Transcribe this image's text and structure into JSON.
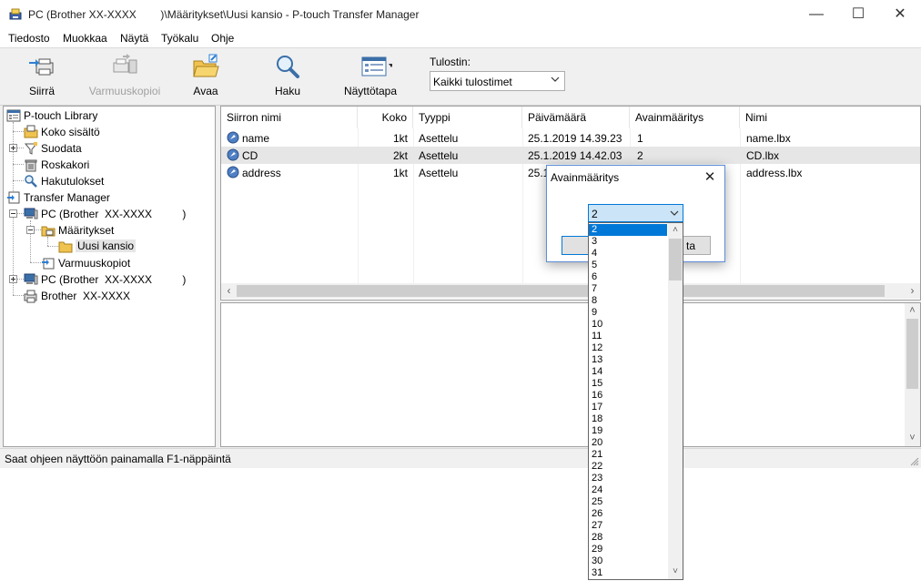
{
  "window": {
    "title": "PC (Brother XX-XXXX        )\\Määritykset\\Uusi kansio - P-touch Transfer Manager",
    "minimize_glyph": "—",
    "maximize_glyph": "☐",
    "close_glyph": "✕"
  },
  "menu": [
    "Tiedosto",
    "Muokkaa",
    "Näytä",
    "Työkalu",
    "Ohje"
  ],
  "toolbar": {
    "transfer": "Siirrä",
    "backup": "Varmuuskopioi",
    "open": "Avaa",
    "search": "Haku",
    "view_style": "Näyttötapa",
    "printer_label": "Tulostin:",
    "printer_value": "Kaikki tulostimet"
  },
  "tree": {
    "library": "P-touch Library",
    "all_contents": "Koko sisältö",
    "filter": "Suodata",
    "trash": "Roskakori",
    "search_results": "Hakutulokset",
    "transfer_manager": "Transfer Manager",
    "pc1": "PC (Brother  XX-XXXX          )",
    "settings": "Määritykset",
    "new_folder": "Uusi kansio",
    "backups": "Varmuuskopiot",
    "pc2": "PC (Brother  XX-XXXX          )",
    "brother": "Brother  XX-XXXX"
  },
  "list": {
    "columns": [
      "Siirron nimi",
      "Koko",
      "Tyyppi",
      "Päivämäärä",
      "Avainmääritys",
      "Nimi"
    ],
    "rows": [
      {
        "name": "name",
        "size": "1kt",
        "type": "Asettelu",
        "date": "25.1.2019 14.39.23",
        "key": "1",
        "file": "name.lbx"
      },
      {
        "name": "CD",
        "size": "2kt",
        "type": "Asettelu",
        "date": "25.1.2019 14.42.03",
        "key": "2",
        "file": "CD.lbx"
      },
      {
        "name": "address",
        "size": "1kt",
        "type": "Asettelu",
        "date": "25.1",
        "key": "",
        "file": "address.lbx"
      }
    ]
  },
  "status": {
    "text": "Saat ohjeen näyttöön painamalla F1-näppäintä"
  },
  "dialog": {
    "title": "Avainmääritys",
    "close_glyph": "✕",
    "selected_value": "2",
    "cancel_fragment": "ta",
    "options": [
      "2",
      "3",
      "4",
      "5",
      "6",
      "7",
      "8",
      "9",
      "10",
      "11",
      "12",
      "13",
      "14",
      "15",
      "16",
      "17",
      "18",
      "19",
      "20",
      "21",
      "22",
      "23",
      "24",
      "25",
      "26",
      "27",
      "28",
      "29",
      "30",
      "31"
    ]
  },
  "colors": {
    "accent": "#0078d7",
    "selection_bg": "#cce4f7",
    "chrome": "#f0f0f0"
  }
}
